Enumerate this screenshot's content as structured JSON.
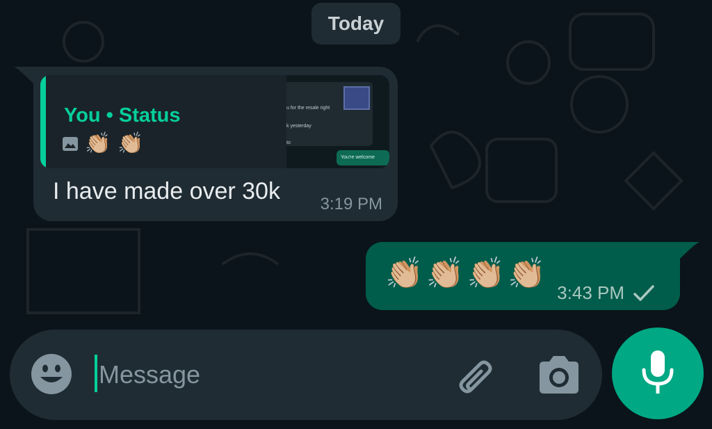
{
  "date_separator": "Today",
  "incoming": {
    "quote_author": "You • Status",
    "quote_emoji": [
      "👏🏼",
      "👏🏼"
    ],
    "quote_thumbnail_lines": [
      "u for the resale right",
      "k yesterday",
      "to",
      "You're welcome"
    ],
    "text": "I have made over 30k",
    "time": "3:19 PM"
  },
  "outgoing": {
    "emoji": "👏🏼👏🏼👏🏼👏🏼",
    "time": "3:43 PM",
    "status_icon": "single-check-icon"
  },
  "composer": {
    "placeholder": "Message",
    "value": "",
    "icons": [
      "emoji-icon",
      "paperclip-icon",
      "camera-icon",
      "microphone-icon"
    ]
  },
  "colors": {
    "background": "#0b141a",
    "incoming_bubble": "#202c33",
    "outgoing_bubble": "#005c4b",
    "accent": "#00a884",
    "quote_accent": "#06cf9c"
  }
}
